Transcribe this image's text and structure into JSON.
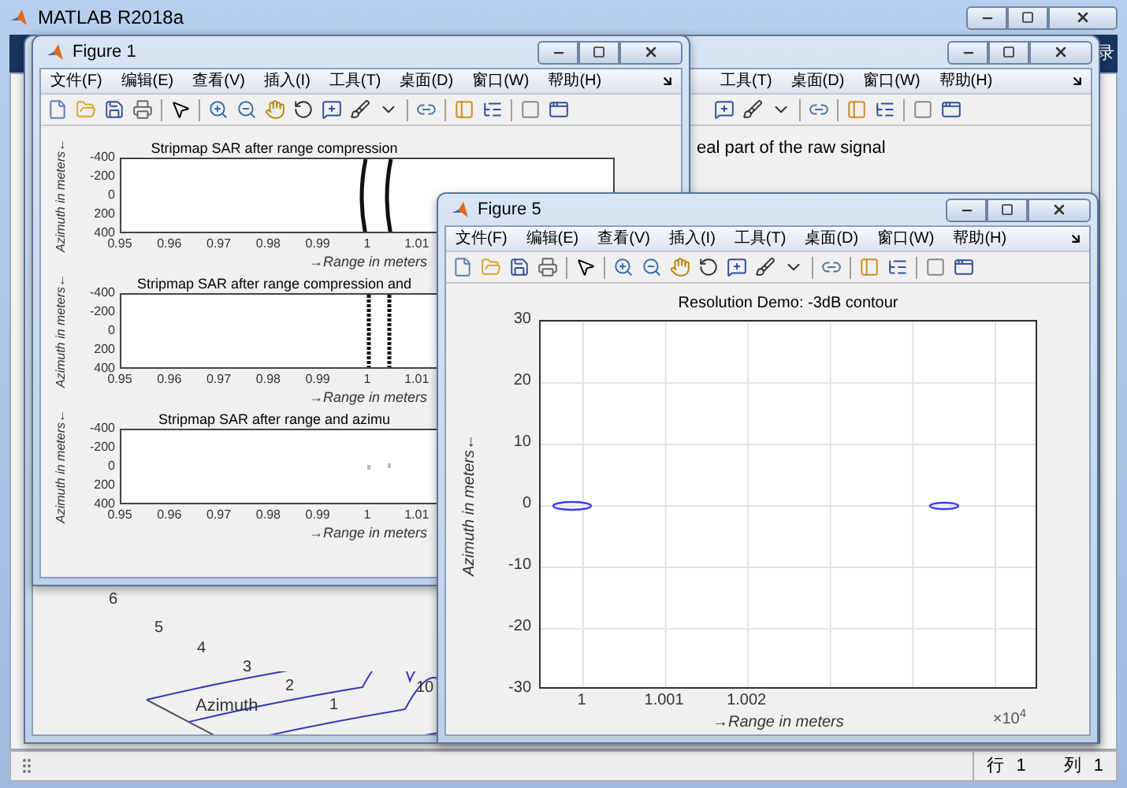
{
  "main_window": {
    "title": "MATLAB R2018a",
    "toolstrip_text": "录",
    "status_bar": {
      "row_label": "行",
      "row": "1",
      "col_label": "列",
      "col": "1"
    }
  },
  "background_figure": {
    "menu": [
      "工具(T)",
      "桌面(D)",
      "窗口(W)",
      "帮助(H)"
    ],
    "plot_title": "eal part of the raw signal",
    "azimuth_ticks": [
      "6",
      "5",
      "4",
      "3",
      "2",
      "1"
    ],
    "azimuth_label": "Azimuth",
    "range_tick": "10"
  },
  "figure1": {
    "title": "Figure 1",
    "menu": [
      "文件(F)",
      "编辑(E)",
      "查看(V)",
      "插入(I)",
      "工具(T)",
      "桌面(D)",
      "窗口(W)",
      "帮助(H)"
    ],
    "subplots": [
      {
        "kind": "curved",
        "title": "Stripmap SAR after range compression",
        "ylabel": "Azimuth in meters←",
        "yticks": [
          "-400",
          "-200",
          "0",
          "200",
          "400"
        ],
        "xticks": [
          "0.95",
          "0.96",
          "0.97",
          "0.98",
          "0.99",
          "1",
          "1.01"
        ],
        "xlabel": "→Range in meters"
      },
      {
        "kind": "dotted",
        "title": "Stripmap SAR after range compression and",
        "ylabel": "Azimuth in meters←",
        "yticks": [
          "-400",
          "-200",
          "0",
          "200",
          "400"
        ],
        "xticks": [
          "0.95",
          "0.96",
          "0.97",
          "0.98",
          "0.99",
          "1",
          "1.01"
        ],
        "xlabel": "→Range in meters"
      },
      {
        "kind": "points",
        "title": "Stripmap SAR after range and azimu",
        "ylabel": "Azimuth in meters←",
        "yticks": [
          "-400",
          "-200",
          "0",
          "200",
          "400"
        ],
        "xticks": [
          "0.95",
          "0.96",
          "0.97",
          "0.98",
          "0.99",
          "1",
          "1.01"
        ],
        "xlabel": "→Range in meters"
      }
    ]
  },
  "figure5": {
    "title": "Figure 5",
    "menu": [
      "文件(F)",
      "编辑(E)",
      "查看(V)",
      "插入(I)",
      "工具(T)",
      "桌面(D)",
      "窗口(W)",
      "帮助(H)"
    ],
    "x_exponent": "×10$^{4}$",
    "plot": {
      "title": "Resolution Demo: -3dB contour",
      "xlabel": "→Range in meters",
      "ylabel": "Azimuth in meters←",
      "xticks": [
        "1",
        "1.001",
        "1.002"
      ],
      "yticks": [
        "30",
        "20",
        "10",
        "0",
        "-10",
        "-20",
        "-30"
      ]
    }
  }
}
